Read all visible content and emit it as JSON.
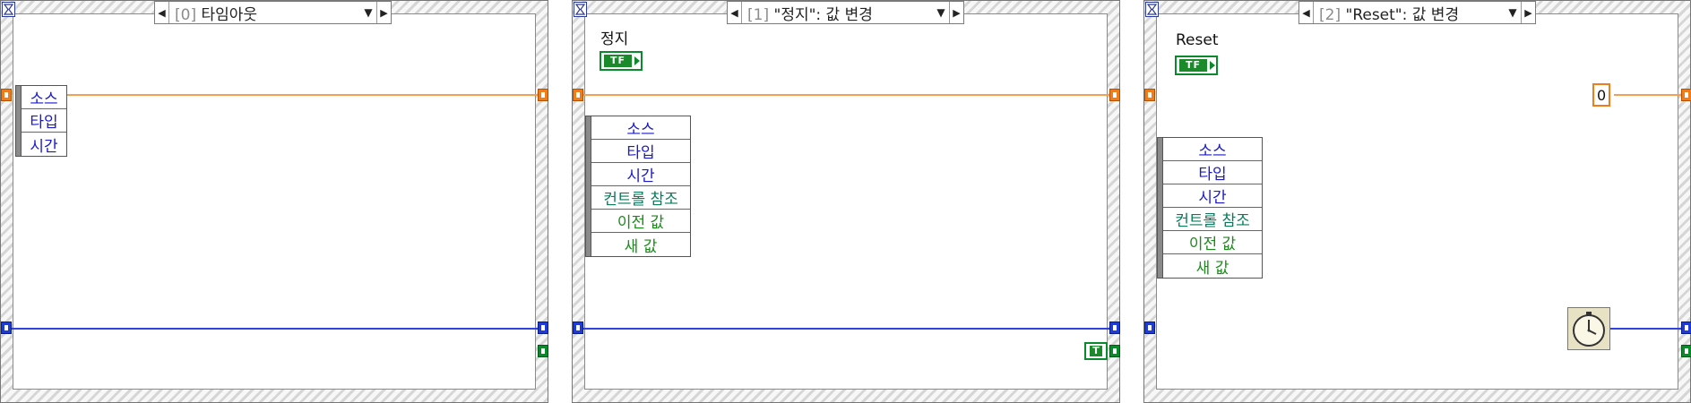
{
  "frames": [
    {
      "selector": {
        "index": "[0]",
        "label": "타임아웃"
      },
      "event_node": [
        "소스",
        "타입",
        "시간"
      ]
    },
    {
      "selector": {
        "index": "[1]",
        "label": "\"정지\": 값 변경"
      },
      "control_label": "정지",
      "bool_text": "TF",
      "event_node": [
        "소스",
        "타입",
        "시간",
        "컨트롤 참조",
        "이전 값",
        "새 값"
      ],
      "true_constant": "T"
    },
    {
      "selector": {
        "index": "[2]",
        "label": "\"Reset\": 값 변경"
      },
      "control_label": "Reset",
      "bool_text": "TF",
      "event_node": [
        "소스",
        "타입",
        "시간",
        "컨트롤 참조",
        "이전 값",
        "새 값"
      ],
      "numeric_constant": "0",
      "icons": [
        "tick-count-timer-icon"
      ]
    }
  ],
  "colors": {
    "wire_numeric": "#f07d1a",
    "wire_error": "#2f43e0",
    "boolean": "#0a8a2a",
    "event_text": "#1a1acc"
  }
}
